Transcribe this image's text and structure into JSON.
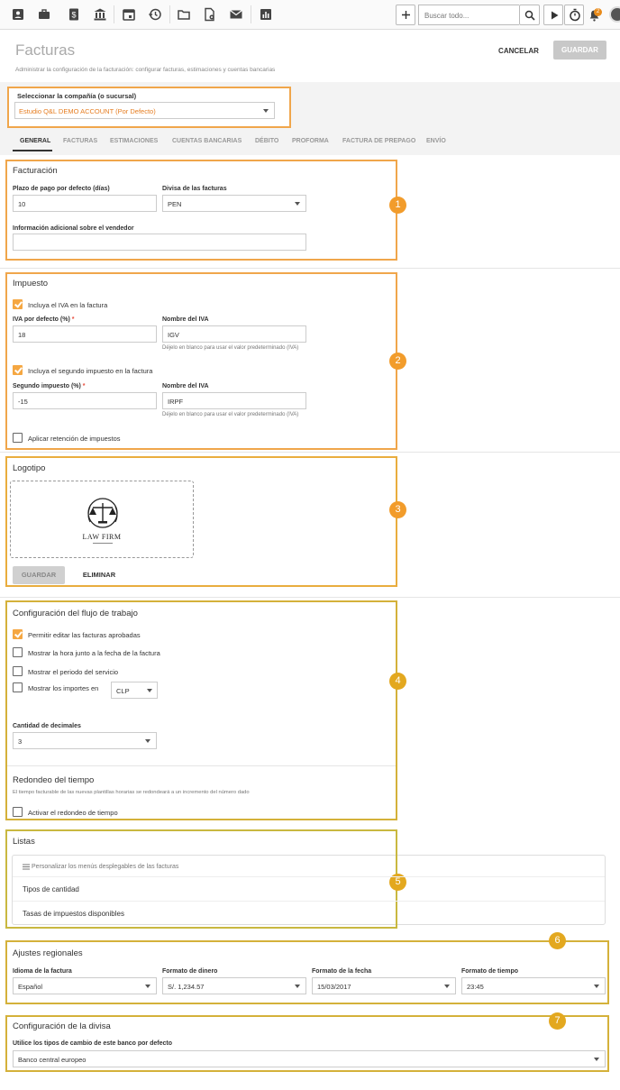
{
  "toolbar": {
    "search_placeholder": "Buscar todo...",
    "notification_count": "2",
    "icons": [
      "contacts-icon",
      "briefcase-icon",
      "invoice-icon",
      "bank-icon",
      "calendar-icon",
      "history-icon",
      "folder-icon",
      "document-settings-icon",
      "mail-icon",
      "reports-icon"
    ]
  },
  "header": {
    "title": "Facturas",
    "subtitle": "Administrar la configuración de la facturación: configurar facturas, estimaciones y cuentas bancarias",
    "cancel_label": "CANCELAR",
    "save_label": "GUARDAR"
  },
  "company": {
    "label": "Seleccionar la compañía (o sucursal)",
    "value": "Estudio Q&L DEMO ACCOUNT (Por Defecto)"
  },
  "tabs": [
    "GENERAL",
    "FACTURAS",
    "ESTIMACIONES",
    "CUENTAS BANCARIAS",
    "DÉBITO",
    "PROFORMA",
    "FACTURA DE PREPAGO",
    "ENVÍO"
  ],
  "billing": {
    "title": "Facturación",
    "payment_term_label": "Plazo de pago por defecto (días)",
    "payment_term_value": "10",
    "currency_label": "Divisa de las facturas",
    "currency_value": "PEN",
    "vendor_info_label": "Información adicional sobre el vendedor",
    "vendor_info_value": ""
  },
  "tax": {
    "title": "Impuesto",
    "include_vat_label": "Incluya el IVA en la factura",
    "include_vat_checked": true,
    "vat_default_label": "IVA por defecto (%)",
    "vat_default_value": "18",
    "vat_name_label": "Nombre del IVA",
    "vat_name_value": "IGV",
    "vat_name_hint": "Déjelo en blanco para usar el valor predeterminado (IVA)",
    "include_second_label": "Incluya el segundo impuesto en la factura",
    "include_second_checked": true,
    "second_tax_label": "Segundo impuesto (%)",
    "second_tax_value": "-15",
    "second_name_label": "Nombre del IVA",
    "second_name_value": "IRPF",
    "second_name_hint": "Déjelo en blanco para usar el valor predeterminado (IVA)",
    "withholding_label": "Aplicar retención de impuestos",
    "withholding_checked": false
  },
  "logo": {
    "title": "Logotipo",
    "logo_text": "LAW FIRM",
    "save_label": "GUARDAR",
    "delete_label": "ELIMINAR"
  },
  "workflow": {
    "title": "Configuración del flujo de trabajo",
    "allow_edit_label": "Permitir editar las facturas aprobadas",
    "allow_edit_checked": true,
    "show_time_label": "Mostrar la hora junto a la fecha de la factura",
    "show_period_label": "Mostrar el periodo del servicio",
    "show_amounts_label": "Mostrar los importes en",
    "amount_currency": "CLP",
    "decimals_label": "Cantidad de decimales",
    "decimals_value": "3"
  },
  "rounding": {
    "title": "Redondeo del tiempo",
    "description": "El tiempo facturable de las nuevas plantillas horarias se redondeará a un incremento del número dado",
    "activate_label": "Activar el redondeo de tiempo"
  },
  "lists": {
    "title": "Listas",
    "customize_label": "Personalizar los menús desplegables de las facturas",
    "items": [
      "Tipos de cantidad",
      "Tasas de impuestos disponibles"
    ]
  },
  "regional": {
    "title": "Ajustes regionales",
    "language_label": "Idioma de la factura",
    "language_value": "Español",
    "money_label": "Formato de dinero",
    "money_value": "S/. 1,234.57",
    "date_label": "Formato de la fecha",
    "date_value": "15/03/2017",
    "time_label": "Formato de tiempo",
    "time_value": "23:45"
  },
  "currency_config": {
    "title": "Configuración de la divisa",
    "bank_label": "Utilice los tipos de cambio de este banco por defecto",
    "bank_value": "Banco central europeo"
  },
  "markers": [
    "1",
    "2",
    "3",
    "4",
    "5",
    "6",
    "7"
  ],
  "colors": {
    "accent": "#f29c2b",
    "frame_orange": "#f0a64b",
    "frame_gold": "#d4b13a"
  }
}
